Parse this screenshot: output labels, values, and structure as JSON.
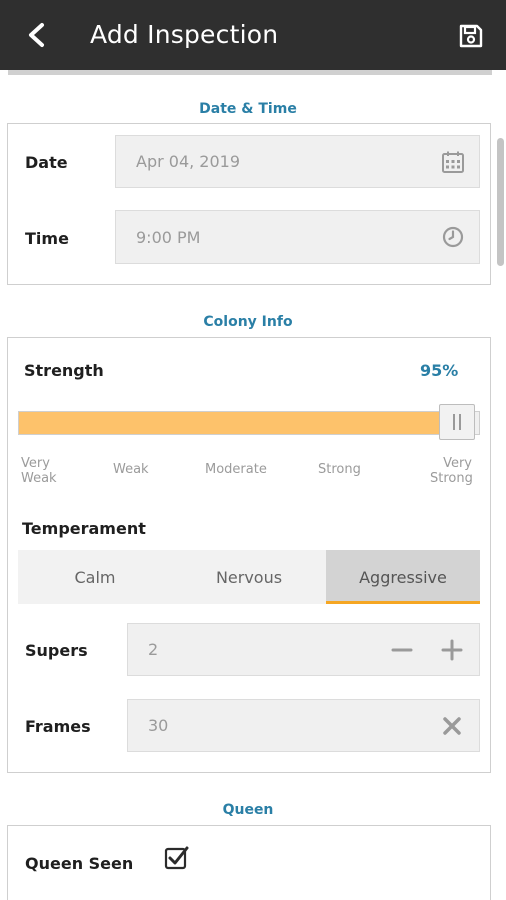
{
  "header": {
    "title": "Add Inspection",
    "back_icon": "chevron-left-icon",
    "save_icon": "floppy-disk-icon"
  },
  "date_time": {
    "section_title": "Date & Time",
    "date_label": "Date",
    "date_value": "Apr 04, 2019",
    "date_icon": "calendar-icon",
    "time_label": "Time",
    "time_value": "9:00 PM",
    "time_icon": "clock-icon"
  },
  "colony": {
    "section_title": "Colony Info",
    "strength_label": "Strength",
    "strength_value_text": "95%",
    "strength_fraction": 0.95,
    "strength_ticks": [
      {
        "line1": "Very",
        "line2": "Weak"
      },
      {
        "line1": "Weak",
        "line2": ""
      },
      {
        "line1": "Moderate",
        "line2": ""
      },
      {
        "line1": "Strong",
        "line2": ""
      },
      {
        "line1": "Very",
        "line2": "Strong"
      }
    ],
    "temperament_label": "Temperament",
    "temperament_options": [
      "Calm",
      "Nervous",
      "Aggressive"
    ],
    "temperament_selected": "Aggressive",
    "supers_label": "Supers",
    "supers_value": "2",
    "frames_label": "Frames",
    "frames_value": "30"
  },
  "queen": {
    "section_title": "Queen",
    "queen_seen_label": "Queen Seen",
    "queen_seen_checked": true
  },
  "colors": {
    "appbar": "#2f2f2f",
    "accent_blue": "#2a7fa6",
    "slider_fill": "#fdc26b",
    "selected_underline": "#f5a623"
  }
}
